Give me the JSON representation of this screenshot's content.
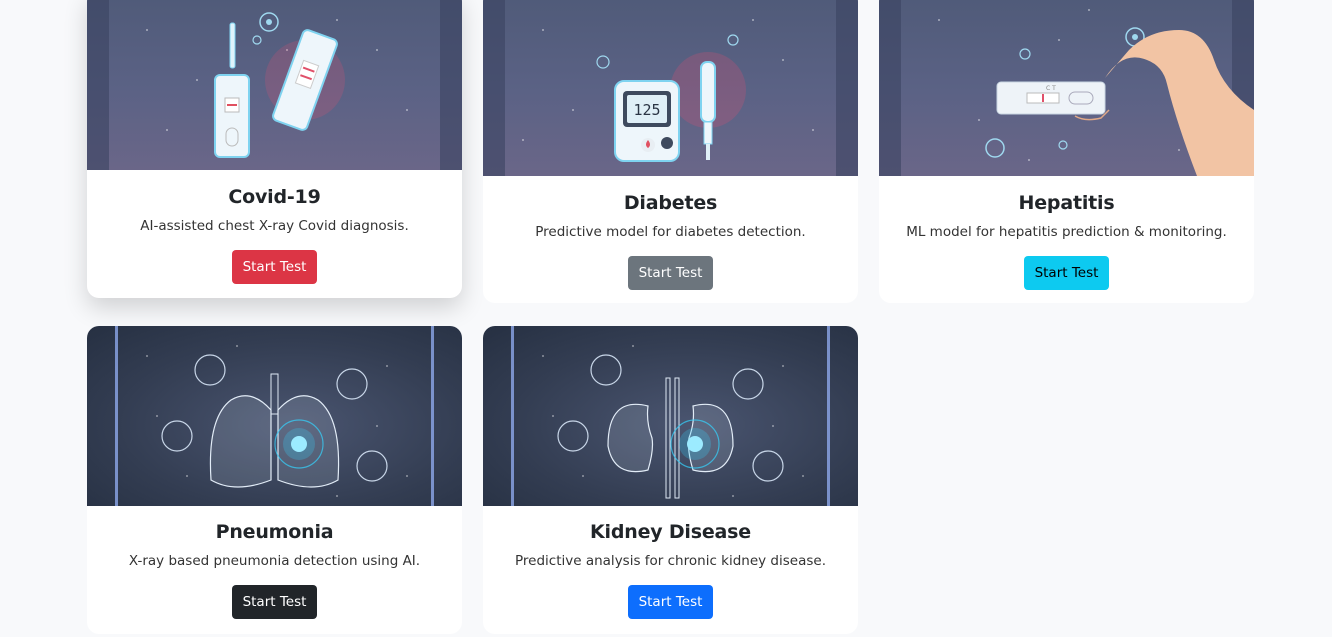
{
  "cards": [
    {
      "title": "Covid-19",
      "desc": "AI-assisted chest X-ray Covid diagnosis.",
      "button": "Start Test"
    },
    {
      "title": "Diabetes",
      "desc": "Predictive model for diabetes detection.",
      "button": "Start Test",
      "display": "125"
    },
    {
      "title": "Hepatitis",
      "desc": "ML model for hepatitis prediction & monitoring.",
      "button": "Start Test",
      "strip_label": "C T"
    },
    {
      "title": "Pneumonia",
      "desc": "X-ray based pneumonia detection using AI.",
      "button": "Start Test"
    },
    {
      "title": "Kidney Disease",
      "desc": "Predictive analysis for chronic kidney disease.",
      "button": "Start Test"
    }
  ],
  "colors": {
    "red": "#dc3545",
    "gray": "#6c757d",
    "cyan": "#0dcaf0",
    "dark": "#212529",
    "blue": "#0d6efd"
  }
}
